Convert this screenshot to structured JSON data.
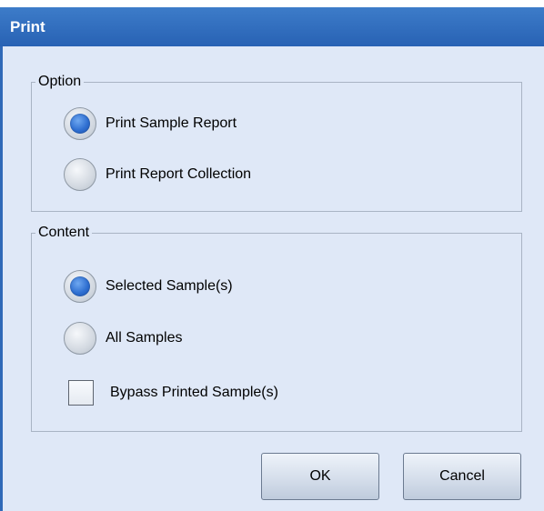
{
  "dialog": {
    "title": "Print"
  },
  "option_group": {
    "label": "Option",
    "items": [
      {
        "label": "Print Sample Report",
        "selected": true
      },
      {
        "label": "Print Report Collection",
        "selected": false
      }
    ]
  },
  "content_group": {
    "label": "Content",
    "items": [
      {
        "label": "Selected Sample(s)",
        "selected": true
      },
      {
        "label": "All Samples",
        "selected": false
      }
    ],
    "bypass": {
      "label": "Bypass Printed Sample(s)",
      "checked": false
    }
  },
  "buttons": {
    "ok_label": "OK",
    "cancel_label": "Cancel"
  },
  "colors": {
    "titlebar": "#2f69b8",
    "body": "#dfe8f7",
    "radio_selected": "#2f6fd1"
  }
}
